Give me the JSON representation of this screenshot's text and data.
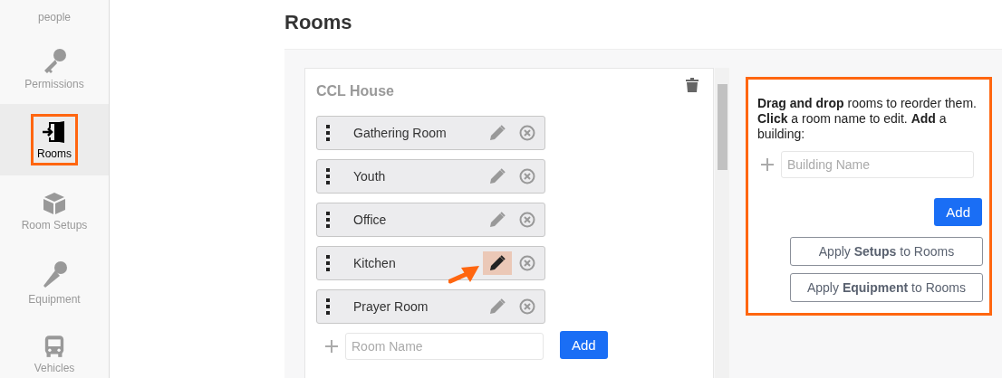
{
  "sidebar": {
    "items": [
      {
        "label": "people",
        "kind": "none",
        "selected": false
      },
      {
        "label": "Permissions",
        "kind": "key",
        "selected": false
      },
      {
        "label": "Rooms",
        "kind": "door",
        "selected": true
      },
      {
        "label": "Room Setups",
        "kind": "box",
        "selected": false
      },
      {
        "label": "Equipment",
        "kind": "mic",
        "selected": false
      },
      {
        "label": "Vehicles",
        "kind": "bus",
        "selected": false
      }
    ]
  },
  "page": {
    "title": "Rooms"
  },
  "building": {
    "name": "CCL House",
    "rooms": [
      {
        "name": "Gathering Room",
        "highlighted": false
      },
      {
        "name": "Youth",
        "highlighted": false
      },
      {
        "name": "Office",
        "highlighted": false
      },
      {
        "name": "Kitchen",
        "highlighted": true
      },
      {
        "name": "Prayer Room",
        "highlighted": false
      }
    ],
    "new_room": {
      "placeholder": "Room Name"
    },
    "add_button": "Add"
  },
  "help": {
    "text": "**Drag and drop** rooms to reorder them. **Click** a room name to edit. **Add** a building:",
    "new_building": {
      "placeholder": "Building Name"
    },
    "add_button": "Add",
    "buttons": [
      "Apply **Setups** to Rooms",
      "Apply **Equipment** to Rooms"
    ]
  }
}
